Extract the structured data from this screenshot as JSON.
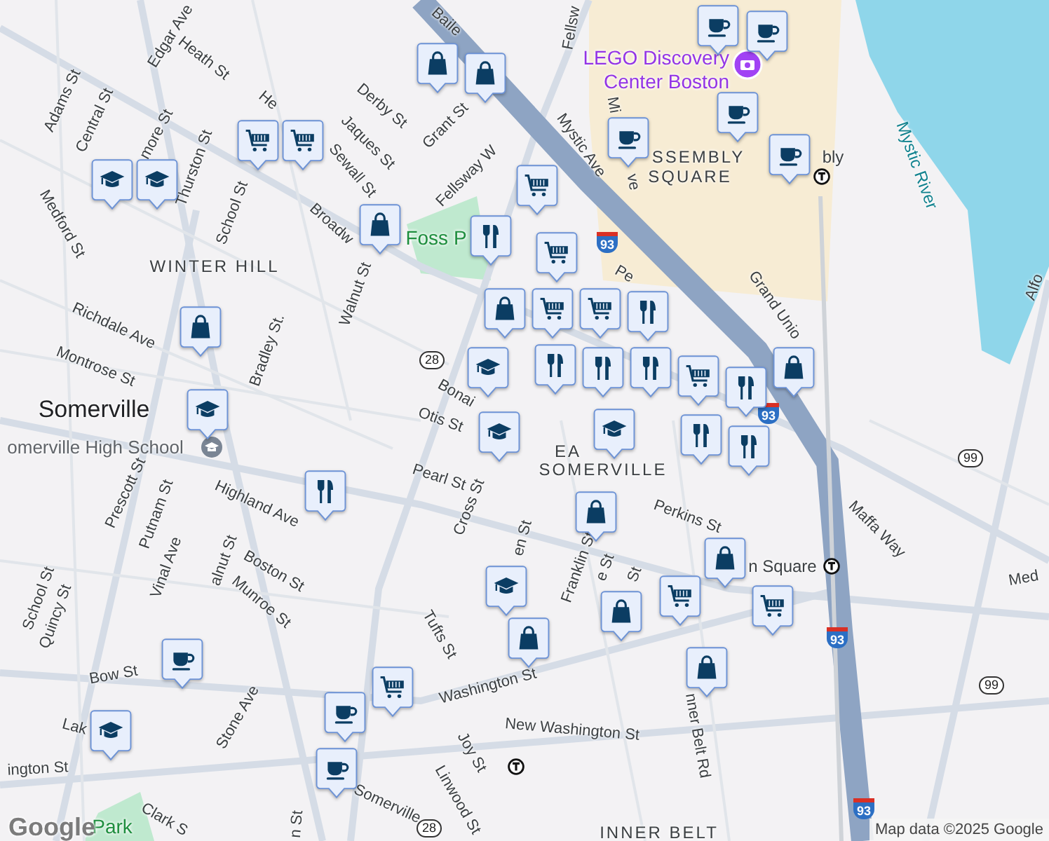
{
  "map": {
    "labels": [
      {
        "text": "Baile",
        "kind": "street"
      },
      {
        "text": "Edgar Ave",
        "kind": "street"
      },
      {
        "text": "Heath St",
        "kind": "street"
      },
      {
        "text": "Adams St",
        "kind": "street"
      },
      {
        "text": "Central St",
        "kind": "street"
      },
      {
        "text": "He",
        "kind": "street"
      },
      {
        "text": "Derby St",
        "kind": "street"
      },
      {
        "text": "Jaques St",
        "kind": "street"
      },
      {
        "text": "Grant St",
        "kind": "street"
      },
      {
        "text": "more St",
        "kind": "street"
      },
      {
        "text": "Sewall St",
        "kind": "street"
      },
      {
        "text": "Thurston St",
        "kind": "street"
      },
      {
        "text": "Fellsway W",
        "kind": "street"
      },
      {
        "text": "Medford St",
        "kind": "street"
      },
      {
        "text": "School St",
        "kind": "street"
      },
      {
        "text": "Broadw",
        "kind": "street"
      },
      {
        "text": "Foss P",
        "kind": "park"
      },
      {
        "text": "WINTER HILL",
        "kind": "area"
      },
      {
        "text": "Walnut St",
        "kind": "street"
      },
      {
        "text": "Richdale Ave",
        "kind": "street"
      },
      {
        "text": "Bradley St.",
        "kind": "street"
      },
      {
        "text": "Montrose St",
        "kind": "street"
      },
      {
        "text": "Somerville",
        "kind": "place"
      },
      {
        "text": "Bonai",
        "kind": "street"
      },
      {
        "text": "Otis St",
        "kind": "street"
      },
      {
        "text": "Fellsw",
        "kind": "street"
      },
      {
        "text": "LEGO Discovery Center Boston",
        "kind": "poi"
      },
      {
        "text": "Mi",
        "kind": "street"
      },
      {
        "text": "ve",
        "kind": "street"
      },
      {
        "text": "SSEMBLY",
        "kind": "area"
      },
      {
        "text": "SQUARE",
        "kind": "area"
      },
      {
        "text": "bly",
        "kind": "station"
      },
      {
        "text": "Mystic Ave",
        "kind": "street"
      },
      {
        "text": "Mystic River",
        "kind": "water"
      },
      {
        "text": "Grand Unio",
        "kind": "street"
      },
      {
        "text": "Alfo",
        "kind": "street"
      },
      {
        "text": "Pe",
        "kind": "street"
      },
      {
        "text": "omerville High School",
        "kind": "school"
      },
      {
        "text": "Pearl St",
        "kind": "street"
      },
      {
        "text": "Cross St",
        "kind": "street"
      },
      {
        "text": "Highland Ave",
        "kind": "street"
      },
      {
        "text": "EA",
        "kind": "area"
      },
      {
        "text": "SOMERVILLE",
        "kind": "area"
      },
      {
        "text": "Perkins St",
        "kind": "street"
      },
      {
        "text": "n Square",
        "kind": "station"
      },
      {
        "text": "Maffa Way",
        "kind": "street"
      },
      {
        "text": "Med",
        "kind": "street"
      },
      {
        "text": "Prescott St",
        "kind": "street"
      },
      {
        "text": "Putnam St",
        "kind": "street"
      },
      {
        "text": "Vinal Ave",
        "kind": "street"
      },
      {
        "text": "alnut St",
        "kind": "street"
      },
      {
        "text": "Boston St",
        "kind": "street"
      },
      {
        "text": "Munroe St",
        "kind": "street"
      },
      {
        "text": "School St",
        "kind": "street"
      },
      {
        "text": "Quincy St",
        "kind": "street"
      },
      {
        "text": "Bow St",
        "kind": "street"
      },
      {
        "text": "Stone Ave",
        "kind": "street"
      },
      {
        "text": "Tufts St",
        "kind": "street"
      },
      {
        "text": "Joy St",
        "kind": "street"
      },
      {
        "text": "Linwood St",
        "kind": "street"
      },
      {
        "text": "Washington St",
        "kind": "street"
      },
      {
        "text": "ington St",
        "kind": "street"
      },
      {
        "text": "Lak",
        "kind": "street"
      },
      {
        "text": "Clark S",
        "kind": "street"
      },
      {
        "text": "Park",
        "kind": "park"
      },
      {
        "text": "Somerville",
        "kind": "street"
      },
      {
        "text": "n St",
        "kind": "street"
      },
      {
        "text": "Franklin St",
        "kind": "street"
      },
      {
        "text": "e St",
        "kind": "street"
      },
      {
        "text": "St",
        "kind": "street"
      },
      {
        "text": "en St",
        "kind": "street"
      },
      {
        "text": "nner Belt Rd",
        "kind": "street"
      },
      {
        "text": "New Washington St",
        "kind": "street"
      },
      {
        "text": "INNER BELT",
        "kind": "area"
      }
    ],
    "shields": [
      {
        "text": "28",
        "kind": "state"
      },
      {
        "text": "28",
        "kind": "state"
      },
      {
        "text": "99",
        "kind": "state"
      },
      {
        "text": "99",
        "kind": "state"
      },
      {
        "text": "93",
        "kind": "interstate"
      },
      {
        "text": "93",
        "kind": "interstate"
      },
      {
        "text": "93",
        "kind": "interstate"
      },
      {
        "text": "93",
        "kind": "interstate"
      }
    ],
    "pins": [
      {
        "kind": "cafe"
      },
      {
        "kind": "cafe"
      },
      {
        "kind": "shop"
      },
      {
        "kind": "shop"
      },
      {
        "kind": "cafe"
      },
      {
        "kind": "cafe"
      },
      {
        "kind": "cafe"
      },
      {
        "kind": "grocery"
      },
      {
        "kind": "grocery"
      },
      {
        "kind": "school"
      },
      {
        "kind": "school"
      },
      {
        "kind": "grocery"
      },
      {
        "kind": "shop"
      },
      {
        "kind": "restaurant"
      },
      {
        "kind": "grocery"
      },
      {
        "kind": "grocery"
      },
      {
        "kind": "shop"
      },
      {
        "kind": "grocery"
      },
      {
        "kind": "restaurant"
      },
      {
        "kind": "school"
      },
      {
        "kind": "restaurant"
      },
      {
        "kind": "restaurant"
      },
      {
        "kind": "restaurant"
      },
      {
        "kind": "grocery"
      },
      {
        "kind": "restaurant"
      },
      {
        "kind": "restaurant"
      },
      {
        "kind": "restaurant"
      },
      {
        "kind": "shop"
      },
      {
        "kind": "shop"
      },
      {
        "kind": "school"
      },
      {
        "kind": "school"
      },
      {
        "kind": "school"
      },
      {
        "kind": "restaurant"
      },
      {
        "kind": "shop"
      },
      {
        "kind": "shop"
      },
      {
        "kind": "grocery"
      },
      {
        "kind": "grocery"
      },
      {
        "kind": "school"
      },
      {
        "kind": "shop"
      },
      {
        "kind": "shop"
      },
      {
        "kind": "shop"
      },
      {
        "kind": "cafe"
      },
      {
        "kind": "grocery"
      },
      {
        "kind": "cafe"
      },
      {
        "kind": "school"
      },
      {
        "kind": "cafe"
      }
    ],
    "logo": "Google",
    "attribution": "Map data ©2025 Google"
  }
}
